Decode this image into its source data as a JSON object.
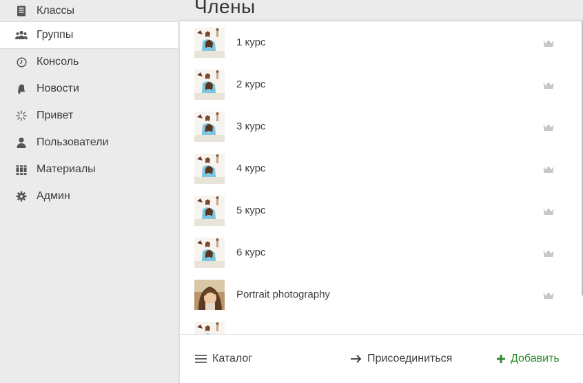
{
  "sidebar": {
    "items": [
      {
        "label": "Классы",
        "icon": "notebook-icon"
      },
      {
        "label": "Группы",
        "icon": "group-icon",
        "active": true
      },
      {
        "label": "Консоль",
        "icon": "clock-icon"
      },
      {
        "label": "Новости",
        "icon": "bell-icon"
      },
      {
        "label": "Привет",
        "icon": "sparkle-icon"
      },
      {
        "label": "Пользователи",
        "icon": "user-icon"
      },
      {
        "label": "Материалы",
        "icon": "books-icon"
      },
      {
        "label": "Админ",
        "icon": "gear-icon"
      }
    ]
  },
  "main": {
    "title": "Члены",
    "members": [
      {
        "name": "1 курс",
        "thumb": "sketch-photo"
      },
      {
        "name": "2 курс",
        "thumb": "sketch-photo"
      },
      {
        "name": "3 курс",
        "thumb": "sketch-photo"
      },
      {
        "name": "4 курс",
        "thumb": "sketch-photo"
      },
      {
        "name": "5 курс",
        "thumb": "sketch-photo"
      },
      {
        "name": "6 курс",
        "thumb": "sketch-photo"
      },
      {
        "name": "Portrait photography",
        "thumb": "portrait-photo"
      }
    ],
    "footer": {
      "catalog_label": "Каталог",
      "join_label": "Присоединиться",
      "add_label": "Добавить"
    }
  },
  "colors": {
    "accent_green": "#2e8b2e",
    "crown": "#c8c8c8",
    "sidebar_bg": "#ebebeb"
  }
}
